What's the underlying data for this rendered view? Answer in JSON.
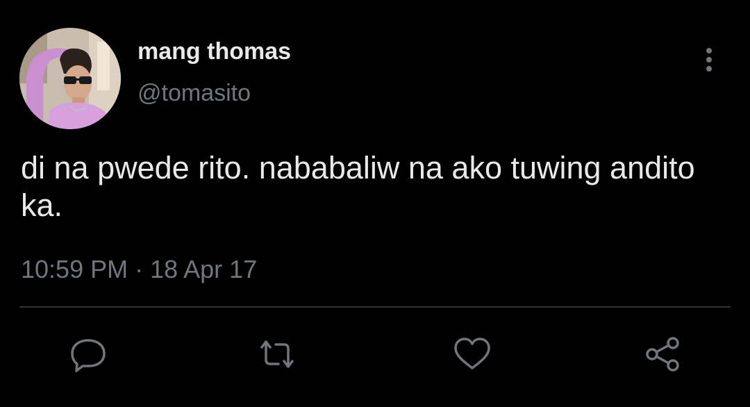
{
  "tweet": {
    "author": {
      "display_name": "mang thomas",
      "handle": "@tomasito",
      "avatar_icon": "profile-photo"
    },
    "text": "di na pwede rito. nababaliw na ako tuwing andito ka.",
    "time": "10:59 PM",
    "separator": "·",
    "date": "18 Apr 17"
  },
  "actions": {
    "reply_icon": "speech-bubble-icon",
    "retweet_icon": "retweet-arrows-icon",
    "like_icon": "heart-icon",
    "share_icon": "share-nodes-icon",
    "more_icon": "vertical-ellipsis-icon"
  },
  "colors": {
    "background": "#000000",
    "primary_text": "#e7e9ea",
    "secondary_text": "#71767b",
    "divider": "#2f3336",
    "icon": "#71767b"
  }
}
